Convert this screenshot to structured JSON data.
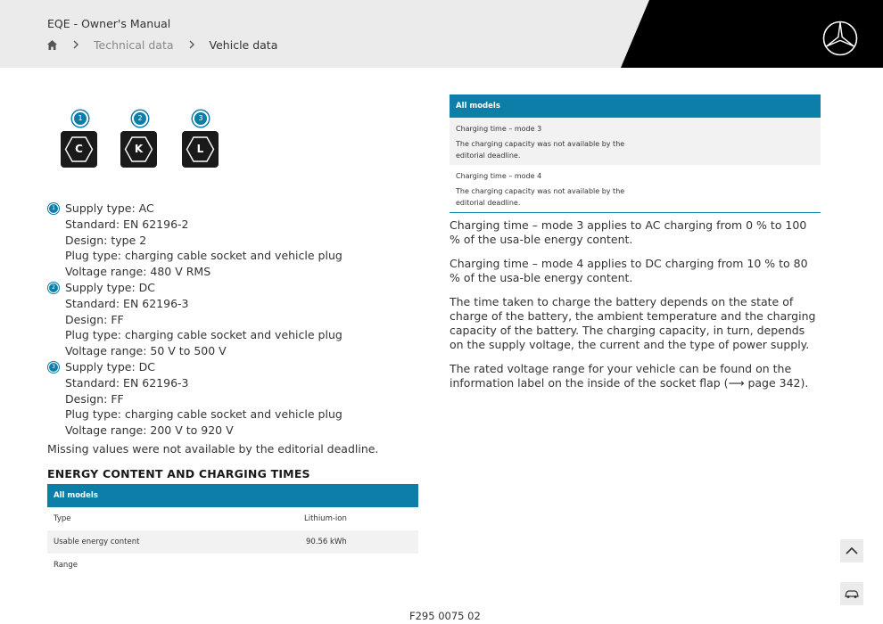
{
  "header": {
    "app_title": "EQE - Owner's Manual",
    "home_icon": "home-icon",
    "breadcrumbs": [
      "Technical data",
      "Vehicle data"
    ],
    "logo": "mercedes-star-logo"
  },
  "plugs": [
    {
      "num": "1",
      "letter": "C"
    },
    {
      "num": "2",
      "letter": "K"
    },
    {
      "num": "3",
      "letter": "L"
    }
  ],
  "specs": [
    {
      "num": "1",
      "lines": [
        "Supply type: AC",
        "Standard: EN 62196-2",
        "Design: type 2",
        "Plug type: charging cable socket and vehicle plug",
        "Voltage range: 480 V RMS"
      ]
    },
    {
      "num": "2",
      "lines": [
        "Supply type: DC",
        "Standard: EN 62196-3",
        "Design: FF",
        "Plug type: charging cable socket and vehicle plug",
        "Voltage range: 50 V to 500 V"
      ]
    },
    {
      "num": "3",
      "lines": [
        "Supply type: DC",
        "Standard: EN 62196-3",
        "Design: FF",
        "Plug type: charging cable socket and vehicle plug",
        "Voltage range: 200 V to 920 V"
      ]
    }
  ],
  "missing_note": "Missing values were not available by the editorial deadline.",
  "section_title": "ENERGY CONTENT AND CHARGING TIMES",
  "energy_table": {
    "header": "All models",
    "rows": [
      {
        "key": "Type",
        "value": "Lithium-ion"
      },
      {
        "key": "Usable energy content",
        "value": "90.56 kWh"
      },
      {
        "key": "Range",
        "value": ""
      }
    ]
  },
  "charging_table": {
    "header": "All models",
    "cells": [
      {
        "title": "Charging time – mode 3",
        "note": "The charging capacity was not available by the editorial deadline."
      },
      {
        "title": "Charging time – mode 4",
        "note": "The charging capacity was not available by the editorial deadline."
      }
    ]
  },
  "paragraphs": [
    "Charging time – mode 3 applies to AC charging from 0 % to 100 % of the usa‑ble energy content.",
    "Charging time – mode 4 applies to DC charging from 10 % to 80 % of the usa‑ble energy content.",
    "The time taken to charge the battery depends on the state of charge of the battery, the ambient temperature and the charging capacity of the battery. The charging capacity, in turn, depends on the supply voltage, the current and the type of power supply.",
    "The rated voltage range for your vehicle can be found on the information label on the inside of the socket flap (⟶ page 342)."
  ],
  "side_buttons": {
    "scroll_top_icon": "chevron-up-icon",
    "car_icon": "car-icon"
  },
  "footer_code": "F295 0075 02"
}
